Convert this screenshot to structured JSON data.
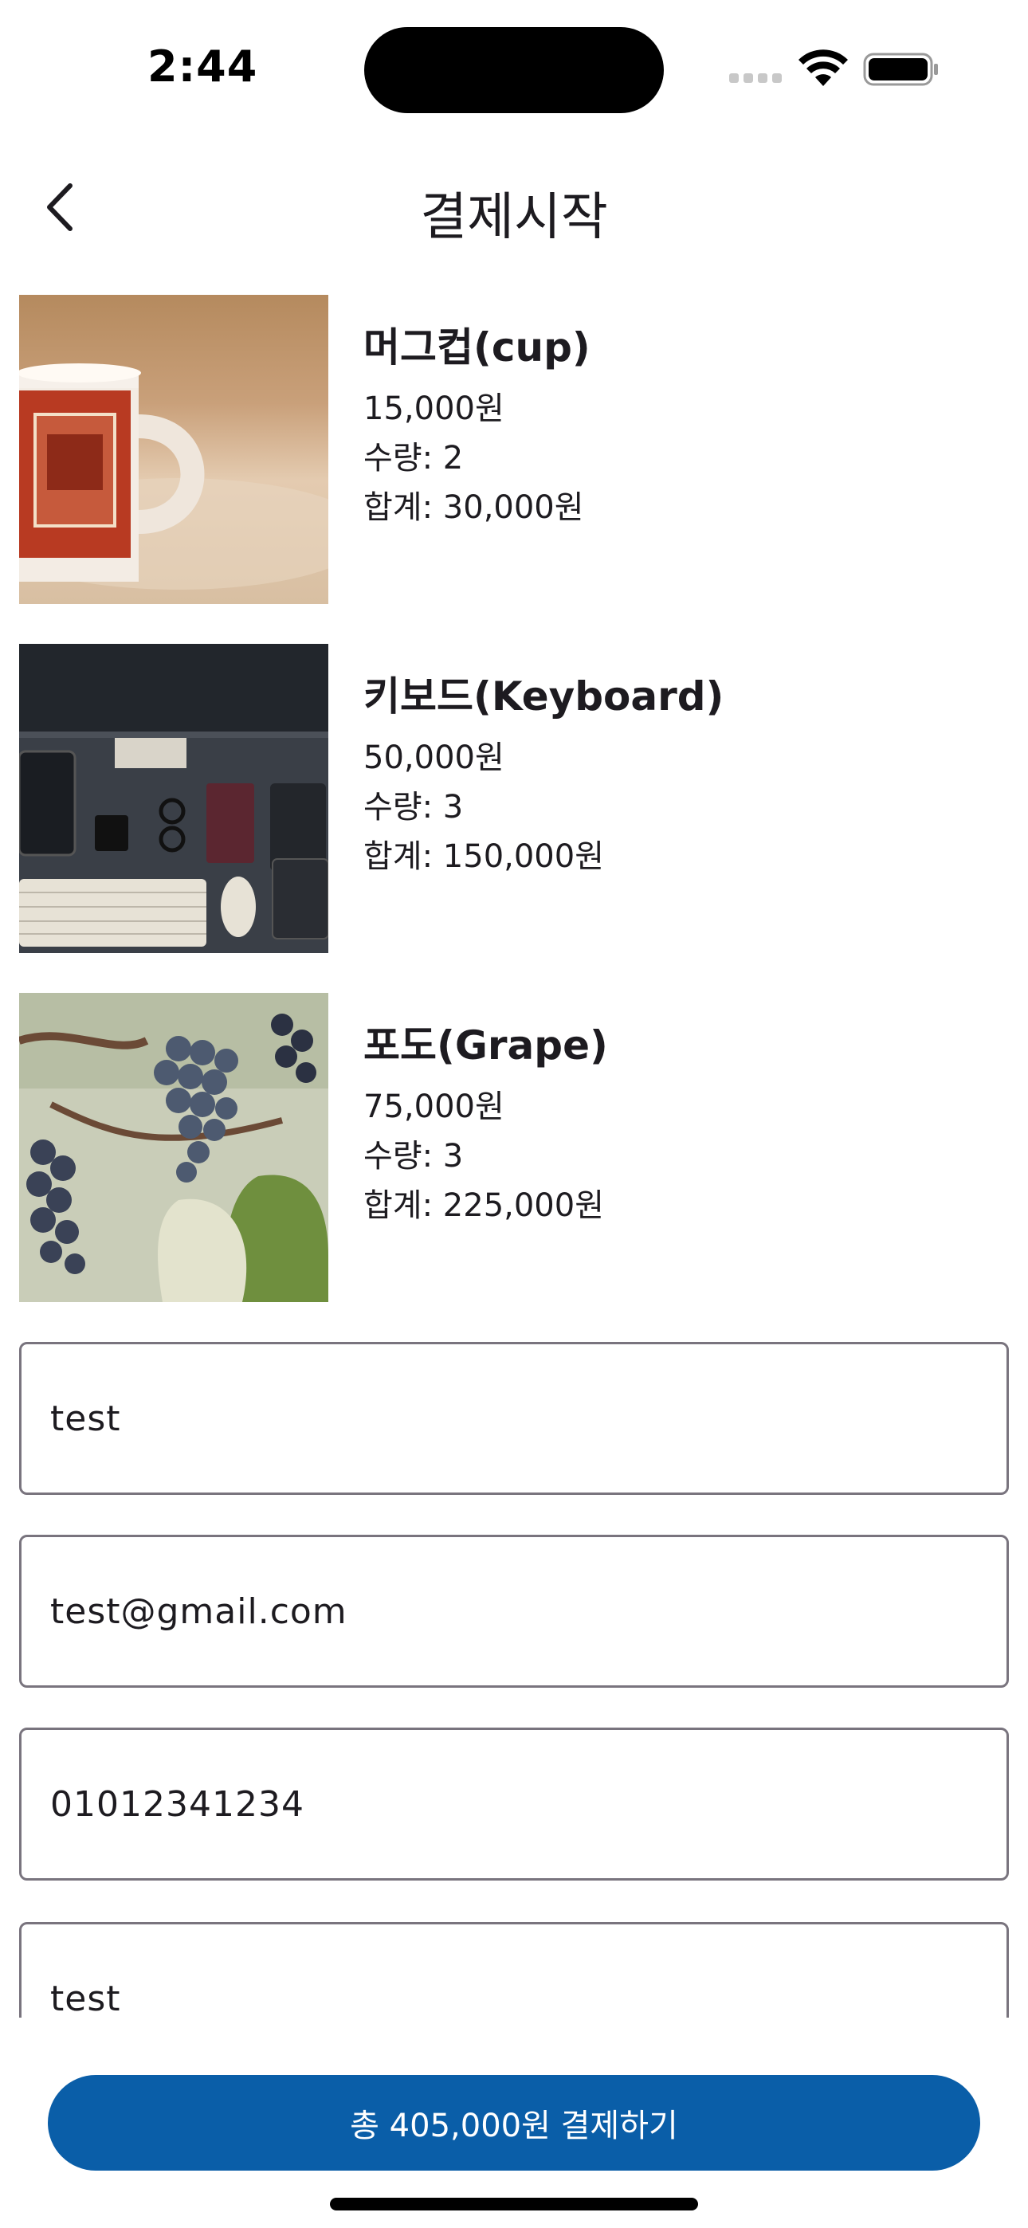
{
  "status_bar": {
    "time": "2:44"
  },
  "app_bar": {
    "title": "결제시작",
    "back_icon": "chevron-left-icon"
  },
  "items": [
    {
      "name": "머그컵(cup)",
      "price": "15,000원",
      "quantity": "수량: 2",
      "total": "합계: 30,000원",
      "image": "mug-photo"
    },
    {
      "name": "키보드(Keyboard)",
      "price": "50,000원",
      "quantity": "수량: 3",
      "total": "합계: 150,000원",
      "image": "keyboard-desk-photo"
    },
    {
      "name": "포도(Grape)",
      "price": "75,000원",
      "quantity": "수량: 3",
      "total": "합계: 225,000원",
      "image": "grape-photo"
    }
  ],
  "form": {
    "name_value": "test",
    "email_value": "test@gmail.com",
    "phone_value": "01012341234",
    "address_value": "test"
  },
  "footer": {
    "pay_button_label": "총 405,000원 결제하기",
    "pay_button_color": "#0a5ea8"
  }
}
